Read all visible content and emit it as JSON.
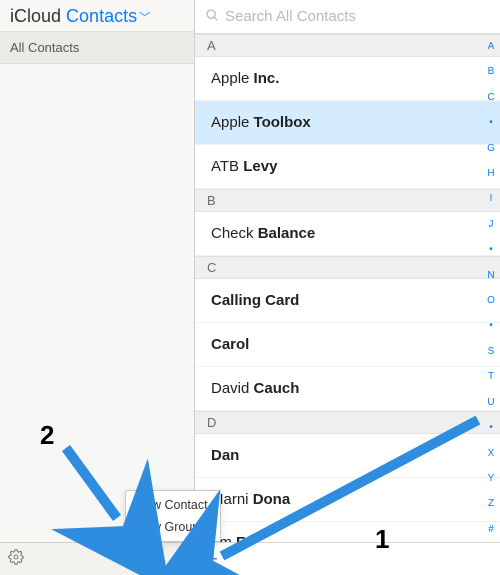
{
  "header": {
    "brand": "iCloud",
    "app_label": "Contacts"
  },
  "sidebar": {
    "groups": [
      {
        "label": "All Contacts"
      }
    ]
  },
  "search": {
    "placeholder": "Search All Contacts"
  },
  "sections": [
    {
      "letter": "A",
      "contacts": [
        {
          "first": "Apple",
          "last": "Inc.",
          "bold": "last",
          "selected": false
        },
        {
          "first": "Apple",
          "last": "Toolbox",
          "bold": "last",
          "selected": true
        },
        {
          "first": "ATB",
          "last": "Levy",
          "bold": "last",
          "selected": false
        }
      ]
    },
    {
      "letter": "B",
      "contacts": [
        {
          "first": "Check",
          "last": "Balance",
          "bold": "last",
          "selected": false
        }
      ]
    },
    {
      "letter": "C",
      "contacts": [
        {
          "first": "Calling Card",
          "last": "",
          "bold": "first",
          "selected": false
        },
        {
          "first": "Carol",
          "last": "",
          "bold": "first",
          "selected": false
        },
        {
          "first": "David",
          "last": "Cauch",
          "bold": "last",
          "selected": false
        }
      ]
    },
    {
      "letter": "D",
      "contacts": [
        {
          "first": "Dan",
          "last": "",
          "bold": "first",
          "selected": false
        },
        {
          "first": "Marni",
          "last": "Dona",
          "bold": "last",
          "selected": false
        }
      ]
    }
  ],
  "partial_row": {
    "first": "am",
    "last": "Fe"
  },
  "index_letters": [
    "A",
    "B",
    "C",
    "•",
    "G",
    "H",
    "I",
    "J",
    "•",
    "N",
    "O",
    "•",
    "S",
    "T",
    "U",
    "•",
    "X",
    "Y",
    "Z",
    "#"
  ],
  "popup": {
    "items": [
      {
        "label": "New Contact"
      },
      {
        "label": "New Group"
      }
    ]
  },
  "annotations": {
    "one": "1",
    "two": "2"
  }
}
